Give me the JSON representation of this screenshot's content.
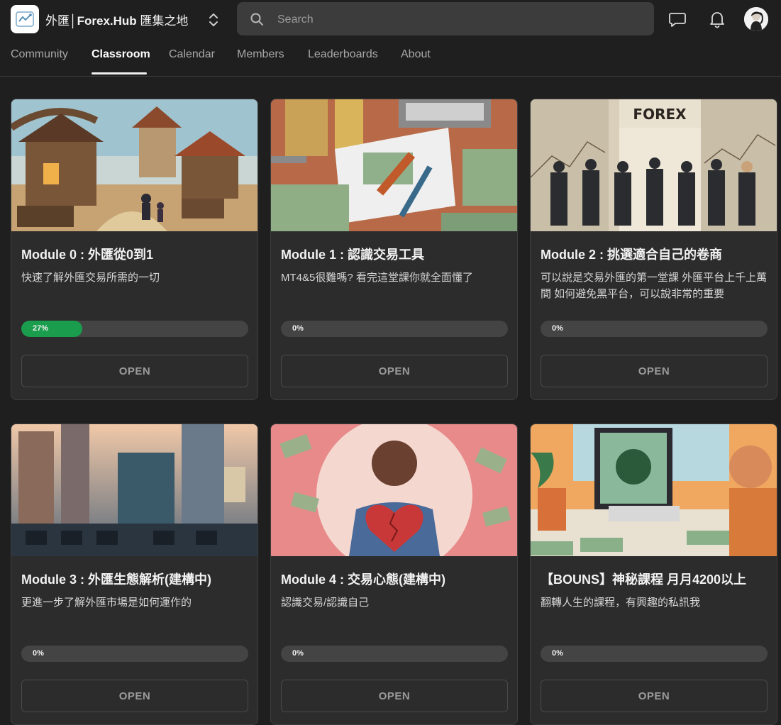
{
  "header": {
    "group_name_prefix": "外匯│",
    "group_name_bold": "Forex.Hub",
    "group_name_suffix": " 匯集之地",
    "search_placeholder": "Search"
  },
  "nav": {
    "tabs": [
      {
        "label": "Community",
        "active": false
      },
      {
        "label": "Classroom",
        "active": true
      },
      {
        "label": "Calendar",
        "active": false
      },
      {
        "label": "Members",
        "active": false
      },
      {
        "label": "Leaderboards",
        "active": false
      },
      {
        "label": "About",
        "active": false
      }
    ]
  },
  "courses": [
    {
      "title": "Module 0 : 外匯從0到1",
      "description": "快速了解外匯交易所需的一切",
      "progress": 27,
      "progress_label": "27%",
      "button": "OPEN",
      "thumbnail": "village-scene"
    },
    {
      "title": "Module 1 : 認識交易工具",
      "description": "MT4&5很難嗎? 看完這堂課你就全面懂了",
      "progress": 0,
      "progress_label": "0%",
      "button": "OPEN",
      "thumbnail": "tools-and-money",
      "thumbnail_text": ""
    },
    {
      "title": "Module 2 : 挑選適合自己的卷商",
      "description": "可以說是交易外匯的第一堂課 外匯平台上千上萬間 如何避免黑平台，可以說非常的重要",
      "progress": 0,
      "progress_label": "0%",
      "button": "OPEN",
      "thumbnail": "forex-guards",
      "thumbnail_text": "FOREX"
    },
    {
      "title": "Module 3 : 外匯生態解析(建構中)",
      "description": "更進一步了解外匯市場是如何運作的",
      "progress": 0,
      "progress_label": "0%",
      "button": "OPEN",
      "thumbnail": "trading-floor"
    },
    {
      "title": "Module 4 : 交易心態(建構中)",
      "description": "認識交易/認識自己",
      "progress": 0,
      "progress_label": "0%",
      "button": "OPEN",
      "thumbnail": "broken-heart-trader"
    },
    {
      "title": "【BOUNS】神秘課程 月月4200以上",
      "description": "翻轉人生的課程，有興趣的私訊我",
      "progress": 0,
      "progress_label": "0%",
      "button": "OPEN",
      "thumbnail": "trader-desk"
    }
  ],
  "icons": [
    "forexhub-logo",
    "chevron-updown-icon",
    "search-icon",
    "chat-icon",
    "bell-icon",
    "user-avatar"
  ],
  "colors": {
    "background": "#1f1f1f",
    "card": "#2c2c2c",
    "progress_fill": "#1a9d4d",
    "search_bg": "#3c3c3c"
  }
}
